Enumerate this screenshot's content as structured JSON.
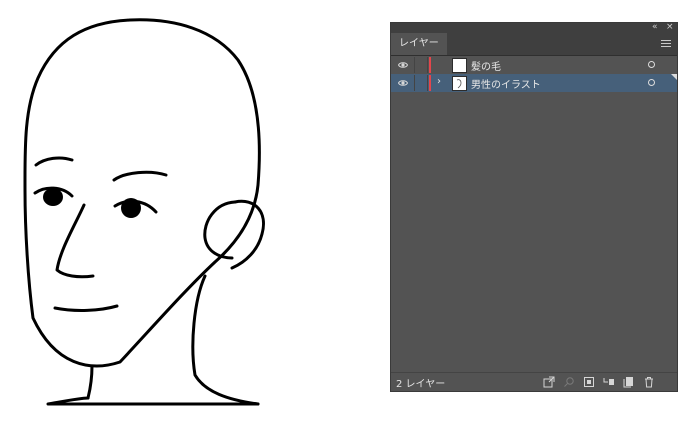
{
  "panel": {
    "tab_label": "レイヤー",
    "collapse_glyph": "«",
    "close_glyph": "×",
    "layers": [
      {
        "name": "髪の毛",
        "visible": true,
        "selected": false,
        "expandable": false,
        "color": "#e3464c"
      },
      {
        "name": "男性のイラスト",
        "visible": true,
        "selected": true,
        "expandable": true,
        "expand_glyph": "›",
        "color": "#e3464c"
      }
    ],
    "footer_count": "2 レイヤー"
  },
  "colors": {
    "panel_bg": "#535353",
    "panel_dark": "#3f3f3f",
    "selection": "#46607a",
    "layer_color": "#e3464c"
  },
  "icons": [
    "eye-icon",
    "expand-arrow-icon",
    "target-circle-icon",
    "panel-menu-icon",
    "export-icon",
    "search-icon",
    "clip-mask-icon",
    "new-sublayer-icon",
    "new-layer-icon",
    "trash-icon"
  ]
}
